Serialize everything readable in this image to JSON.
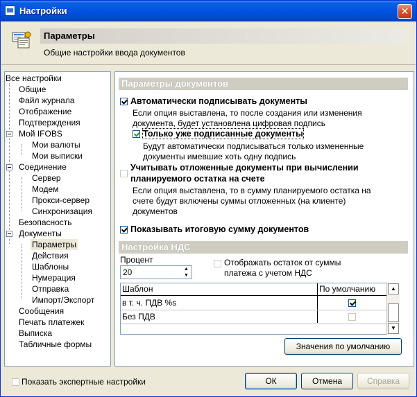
{
  "window": {
    "title": "Настройки"
  },
  "header": {
    "title": "Параметры",
    "subtitle": "Общие настройки ввода документов"
  },
  "tree": {
    "items": [
      {
        "label": "Все настройки"
      },
      {
        "label": "Общие"
      },
      {
        "label": "Файл журнала"
      },
      {
        "label": "Отображение"
      },
      {
        "label": "Подтверждения"
      },
      {
        "label": "Мой IFOBS"
      },
      {
        "label": "Мои валюты"
      },
      {
        "label": "Мои выписки"
      },
      {
        "label": "Соединение"
      },
      {
        "label": "Сервер"
      },
      {
        "label": "Модем"
      },
      {
        "label": "Прокси-сервер"
      },
      {
        "label": "Синхронизация"
      },
      {
        "label": "Безопасность"
      },
      {
        "label": "Документы"
      },
      {
        "label": "Параметры"
      },
      {
        "label": "Действия"
      },
      {
        "label": "Шаблоны"
      },
      {
        "label": "Нумерация"
      },
      {
        "label": "Отправка"
      },
      {
        "label": "Импорт/Экспорт"
      },
      {
        "label": "Сообщения"
      },
      {
        "label": "Печать платежек"
      },
      {
        "label": "Выписка"
      },
      {
        "label": "Табличные формы"
      }
    ]
  },
  "docs": {
    "section_title": "Параметры документов",
    "auto_sign": {
      "label": "Автоматически подписывать документы",
      "desc1": "Если опция выставлена, то после создания или изменения",
      "desc2": "документа, будет установлена цифровая подпись"
    },
    "only_signed": {
      "label": "Только уже подписанные документы",
      "desc1": "Будут автоматически подписываться только измененные",
      "desc2": "документы имевшие хоть одну подпись"
    },
    "deferred": {
      "label1": "Учитывать отложенные документы при вычислении",
      "label2": "планируемого остатка на счете",
      "desc1": "Если опция выставлена, то в сумму планируемого остатка на",
      "desc2": "счете будут включены суммы отложенных (на клиенте)",
      "desc3": "документов"
    },
    "show_total": {
      "label": "Показывать итоговую сумму документов"
    }
  },
  "vat": {
    "section_title": "Настройка НДС",
    "percent_label": "Процент",
    "percent_value": "20",
    "show_remainder_1": "Отображать остаток от суммы",
    "show_remainder_2": "платежа с учетом НДС",
    "columns": [
      "Шаблон",
      "По умолчанию"
    ],
    "rows": [
      {
        "template": "в т. ч. ПДВ %s",
        "default": true
      },
      {
        "template": "Без ПДВ",
        "default": false
      }
    ],
    "defaults_button": "Значения по умолчанию"
  },
  "footer": {
    "expert_label": "Показать экспертные настройки",
    "ok": "ОК",
    "cancel": "Отмена",
    "apply": "Справка"
  }
}
